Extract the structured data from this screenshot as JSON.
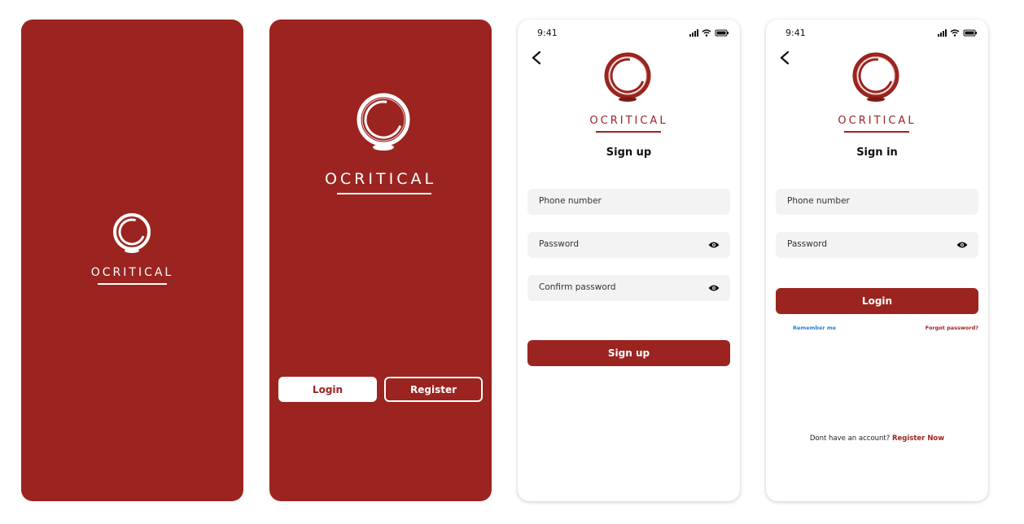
{
  "colors": {
    "brand_red": "#9b2420",
    "field_bg": "#f3f3f3",
    "link_blue": "#2a7fd4"
  },
  "brand": {
    "name": "OCRITICAL"
  },
  "status_bar": {
    "time": "9:41"
  },
  "welcome": {
    "login_label": "Login",
    "register_label": "Register"
  },
  "signup": {
    "title": "Sign up",
    "phone_placeholder": "Phone number",
    "password_placeholder": "Password",
    "confirm_placeholder": "Confirm password",
    "submit_label": "Sign up"
  },
  "signin": {
    "title": "Sign in",
    "phone_placeholder": "Phone number",
    "password_placeholder": "Password",
    "submit_label": "Login",
    "remember_label": "Remember me",
    "forgot_label": "Forgot password?",
    "no_account_text": "Dont have an account?",
    "register_link": "Register Now"
  },
  "icons": [
    "logo-ring-icon",
    "signal-icon",
    "wifi-icon",
    "battery-icon",
    "back-arrow-icon",
    "eye-icon"
  ]
}
